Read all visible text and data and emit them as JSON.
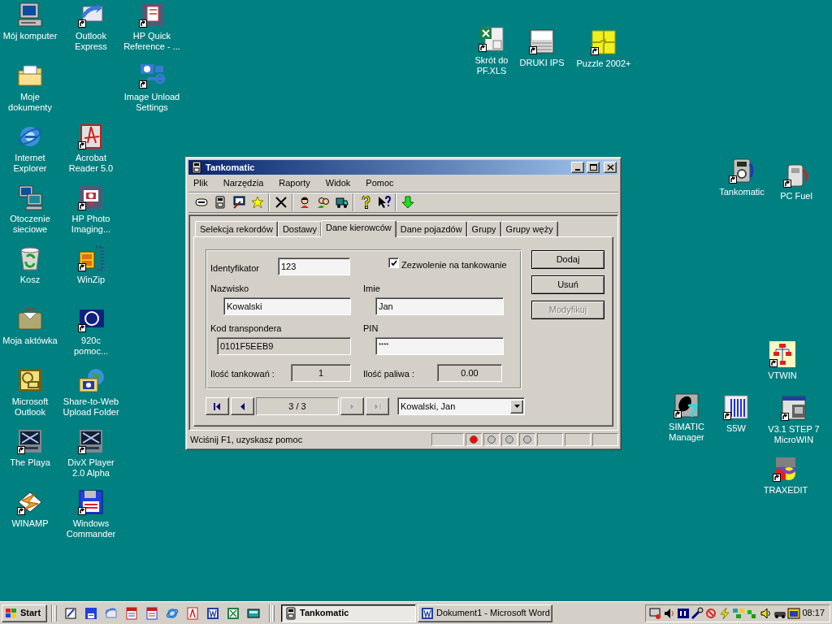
{
  "desktop_icons": [
    {
      "label": "Mój komputer",
      "shortcut": false
    },
    {
      "label": "Outlook\nExpress",
      "shortcut": true
    },
    {
      "label": "HP Quick\nReference - ...",
      "shortcut": true
    },
    {
      "label": "Moje\ndokumenty",
      "shortcut": false
    },
    {
      "label": "Image Unload\nSettings",
      "shortcut": true
    },
    {
      "label": "Internet\nExplorer",
      "shortcut": false
    },
    {
      "label": "Acrobat\nReader 5.0",
      "shortcut": true
    },
    {
      "label": "Otoczenie\nsieciowe",
      "shortcut": false
    },
    {
      "label": "HP Photo\nImaging...",
      "shortcut": true
    },
    {
      "label": "Kosz",
      "shortcut": false
    },
    {
      "label": "WinZip",
      "shortcut": true
    },
    {
      "label": "Moja aktówka",
      "shortcut": false
    },
    {
      "label": "920c\npomoc...",
      "shortcut": true
    },
    {
      "label": "Microsoft\nOutlook",
      "shortcut": false
    },
    {
      "label": "Share-to-Web\nUpload Folder",
      "shortcut": false
    },
    {
      "label": "The Playa",
      "shortcut": true
    },
    {
      "label": "DivX Player\n2.0 Alpha",
      "shortcut": true
    },
    {
      "label": "WINAMP",
      "shortcut": true
    },
    {
      "label": "Windows\nCommander",
      "shortcut": true
    },
    {
      "label": "Skrót do\nPF.XLS",
      "shortcut": true
    },
    {
      "label": "DRUKI IPS",
      "shortcut": true
    },
    {
      "label": "Puzzle 2002+",
      "shortcut": true
    },
    {
      "label": "Tankomatic",
      "shortcut": true
    },
    {
      "label": "PC Fuel",
      "shortcut": true
    },
    {
      "label": "VTWIN",
      "shortcut": true
    },
    {
      "label": "SIMATIC\nManager",
      "shortcut": true
    },
    {
      "label": "S5W",
      "shortcut": true
    },
    {
      "label": "V3.1 STEP 7\nMicroWIN",
      "shortcut": true
    },
    {
      "label": "TRAXEDIT",
      "shortcut": true
    }
  ],
  "window": {
    "title": "Tankomatic",
    "menu": [
      "Plik",
      "Narzędzia",
      "Raporty",
      "Widok",
      "Pomoc"
    ],
    "tabs": [
      {
        "label": "Selekcja rekordów",
        "selected": false
      },
      {
        "label": "Dostawy",
        "selected": false
      },
      {
        "label": "Dane kierowców",
        "selected": true
      },
      {
        "label": "Dane pojazdów",
        "selected": false
      },
      {
        "label": "Grupy",
        "selected": false
      },
      {
        "label": "Grupy węży",
        "selected": false
      }
    ],
    "form": {
      "id_label": "Identyfikator",
      "id_value": "123",
      "permit": {
        "label": "Zezwolenie na tankowanie",
        "checked": true
      },
      "surname_label": "Nazwisko",
      "surname_value": "Kowalski",
      "name_label": "Imie",
      "name_value": "Jan",
      "transponder_label": "Kod transpondera",
      "transponder_value": "0101F5EEB9",
      "transponder_disabled": true,
      "pin_label": "PIN",
      "pin_value": "****",
      "refuels_label": "Ilość tankowań :",
      "refuels_value": "1",
      "fuel_label": "Ilość paliwa :",
      "fuel_value": "0.00"
    },
    "buttons": [
      {
        "label": "Dodaj",
        "disabled": false
      },
      {
        "label": "Usuń",
        "disabled": false
      },
      {
        "label": "Modyfikuj",
        "disabled": true
      }
    ],
    "navigator": {
      "buttons": [
        {
          "disabled": false
        },
        {
          "disabled": false
        },
        {
          "disabled": true
        },
        {
          "disabled": true
        }
      ],
      "position": "3 / 3",
      "record": "Kowalski, Jan"
    },
    "status_bar": {
      "text": "Wciśnij F1, uzyskasz pomoc",
      "leds": [
        {
          "on": true
        },
        {
          "on": false
        },
        {
          "on": false
        },
        {
          "on": false
        }
      ]
    }
  },
  "taskbar": {
    "start": "Start",
    "tasks": [
      {
        "label": "Tankomatic",
        "selected": true
      },
      {
        "label": "Dokument1 - Microsoft Word",
        "selected": false
      }
    ],
    "clock": "08:17"
  }
}
